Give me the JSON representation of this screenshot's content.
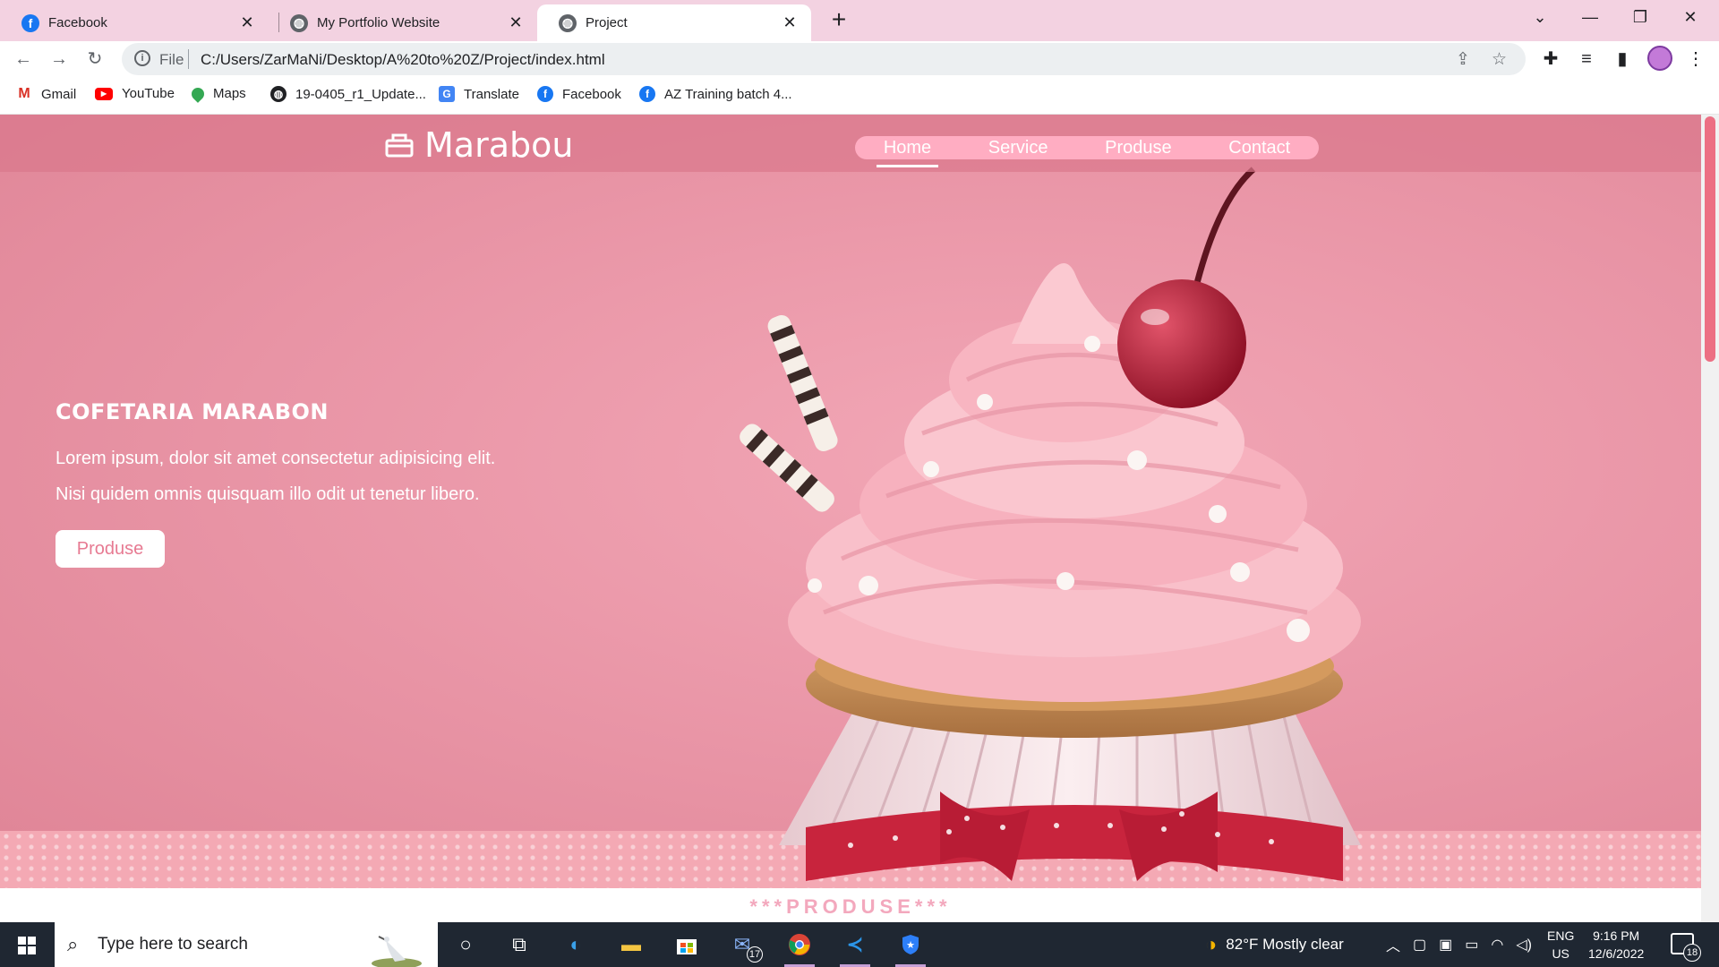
{
  "browser": {
    "tabs": [
      {
        "title": "Facebook",
        "icon": "facebook-icon",
        "active": false
      },
      {
        "title": "My Portfolio Website",
        "icon": "globe-icon",
        "active": false
      },
      {
        "title": "Project",
        "icon": "globe-icon",
        "active": true
      }
    ],
    "address": {
      "scheme": "File",
      "url": "C:/Users/ZarMaNi/Desktop/A%20to%20Z/Project/index.html"
    },
    "bookmarks": [
      {
        "label": "Gmail",
        "icon": "gmail-icon"
      },
      {
        "label": "YouTube",
        "icon": "youtube-icon"
      },
      {
        "label": "Maps",
        "icon": "maps-icon"
      },
      {
        "label": "19-0405_r1_Update...",
        "icon": "globe-icon"
      },
      {
        "label": "Translate",
        "icon": "translate-icon"
      },
      {
        "label": "Facebook",
        "icon": "facebook-icon"
      },
      {
        "label": "AZ Training batch 4...",
        "icon": "facebook-icon"
      }
    ]
  },
  "page": {
    "brand": "Marabou",
    "nav": [
      "Home",
      "Service",
      "Produse",
      "Contact"
    ],
    "active_nav": "Home",
    "hero": {
      "title": "COFETARIA MARABON",
      "line1": "Lorem ipsum, dolor sit amet consectetur adipisicing elit.",
      "line2": "Nisi quidem omnis quisquam illo odit ut tenetur libero.",
      "button": "Produse"
    },
    "section_title": "***PRODUSE***"
  },
  "taskbar": {
    "search_placeholder": "Type here to search",
    "mail_badge": "17",
    "weather": "82°F  Mostly clear",
    "lang_top": "ENG",
    "lang_bottom": "US",
    "time": "9:16 PM",
    "date": "12/6/2022",
    "notifications": "18"
  },
  "colors": {
    "accent": "#e77a92",
    "nav_pill": "#ffadc2",
    "hero": "#ea97a8"
  }
}
